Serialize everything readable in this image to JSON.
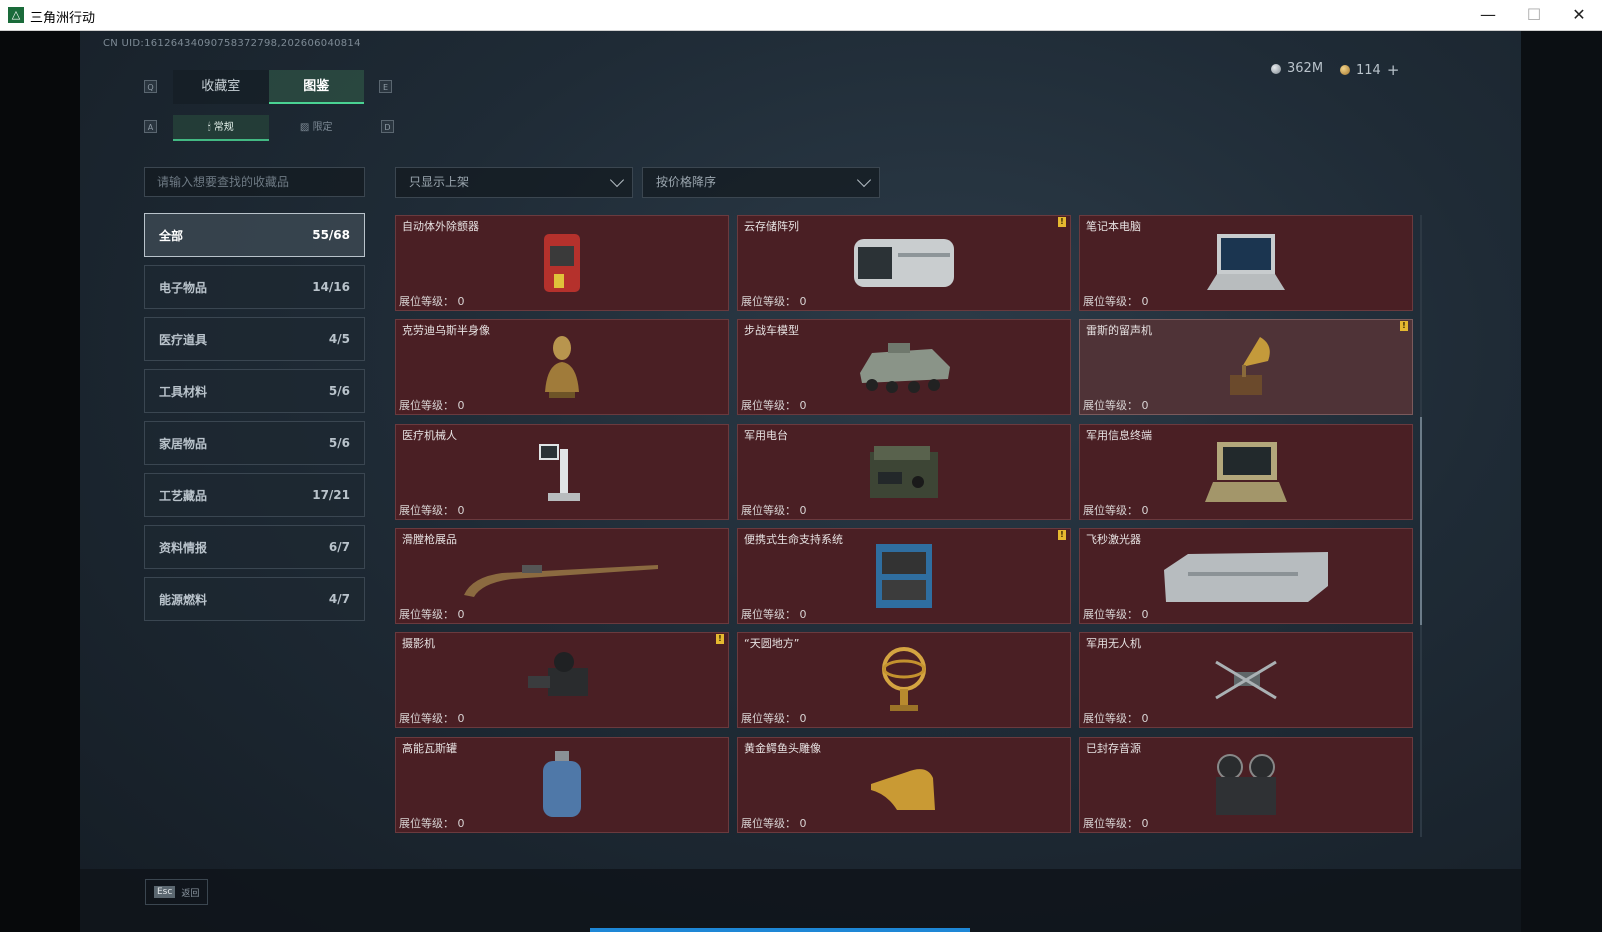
{
  "window": {
    "title": "三角洲行动",
    "logo_glyph": "△",
    "minimize": "—",
    "maximize": "☐",
    "close": "✕"
  },
  "uid": "CN UID:16126434090758372798,202606040814",
  "currency": {
    "silver": "362M",
    "gold": "114",
    "add": "+"
  },
  "keys": {
    "tab_prev": "Q",
    "tab_next": "E",
    "sub_prev": "A",
    "sub_next": "D"
  },
  "tabs": [
    {
      "label": "收藏室"
    },
    {
      "label": "图鉴"
    }
  ],
  "subtabs": [
    {
      "icon": "🕯",
      "label": "常规"
    },
    {
      "icon": "▨",
      "label": "限定"
    }
  ],
  "search": {
    "placeholder": "请输入想要查找的收藏品"
  },
  "categories": [
    {
      "label": "全部",
      "count": "55/68"
    },
    {
      "label": "电子物品",
      "count": "14/16"
    },
    {
      "label": "医疗道具",
      "count": "4/5"
    },
    {
      "label": "工具材料",
      "count": "5/6"
    },
    {
      "label": "家居物品",
      "count": "5/6"
    },
    {
      "label": "工艺藏品",
      "count": "17/21"
    },
    {
      "label": "资料情报",
      "count": "6/7"
    },
    {
      "label": "能源燃料",
      "count": "4/7"
    }
  ],
  "filters": {
    "shelf": "只显示上架",
    "sort": "按价格降序"
  },
  "level_label": "展位等级：",
  "items": [
    {
      "name": "自动体外除颤器",
      "level": "0",
      "alert": ""
    },
    {
      "name": "云存储阵列",
      "level": "0",
      "alert": "!"
    },
    {
      "name": "笔记本电脑",
      "level": "0",
      "alert": ""
    },
    {
      "name": "克劳迪乌斯半身像",
      "level": "0",
      "alert": ""
    },
    {
      "name": "步战车模型",
      "level": "0",
      "alert": ""
    },
    {
      "name": "雷斯的留声机",
      "level": "0",
      "alert": "!"
    },
    {
      "name": "医疗机械人",
      "level": "0",
      "alert": ""
    },
    {
      "name": "军用电台",
      "level": "0",
      "alert": ""
    },
    {
      "name": "军用信息终端",
      "level": "0",
      "alert": ""
    },
    {
      "name": "滑膛枪展品",
      "level": "0",
      "alert": ""
    },
    {
      "name": "便携式生命支持系统",
      "level": "0",
      "alert": "!"
    },
    {
      "name": "飞秒激光器",
      "level": "0",
      "alert": ""
    },
    {
      "name": "摄影机",
      "level": "0",
      "alert": "!"
    },
    {
      "name": "“天圆地方”",
      "level": "0",
      "alert": ""
    },
    {
      "name": "军用无人机",
      "level": "0",
      "alert": ""
    },
    {
      "name": "高能瓦斯罐",
      "level": "0",
      "alert": ""
    },
    {
      "name": "黄金鳄鱼头雕像",
      "level": "0",
      "alert": ""
    },
    {
      "name": "已封存音源",
      "level": "0",
      "alert": ""
    }
  ],
  "footer": {
    "esc_key": "Esc",
    "back_label": "返回"
  }
}
